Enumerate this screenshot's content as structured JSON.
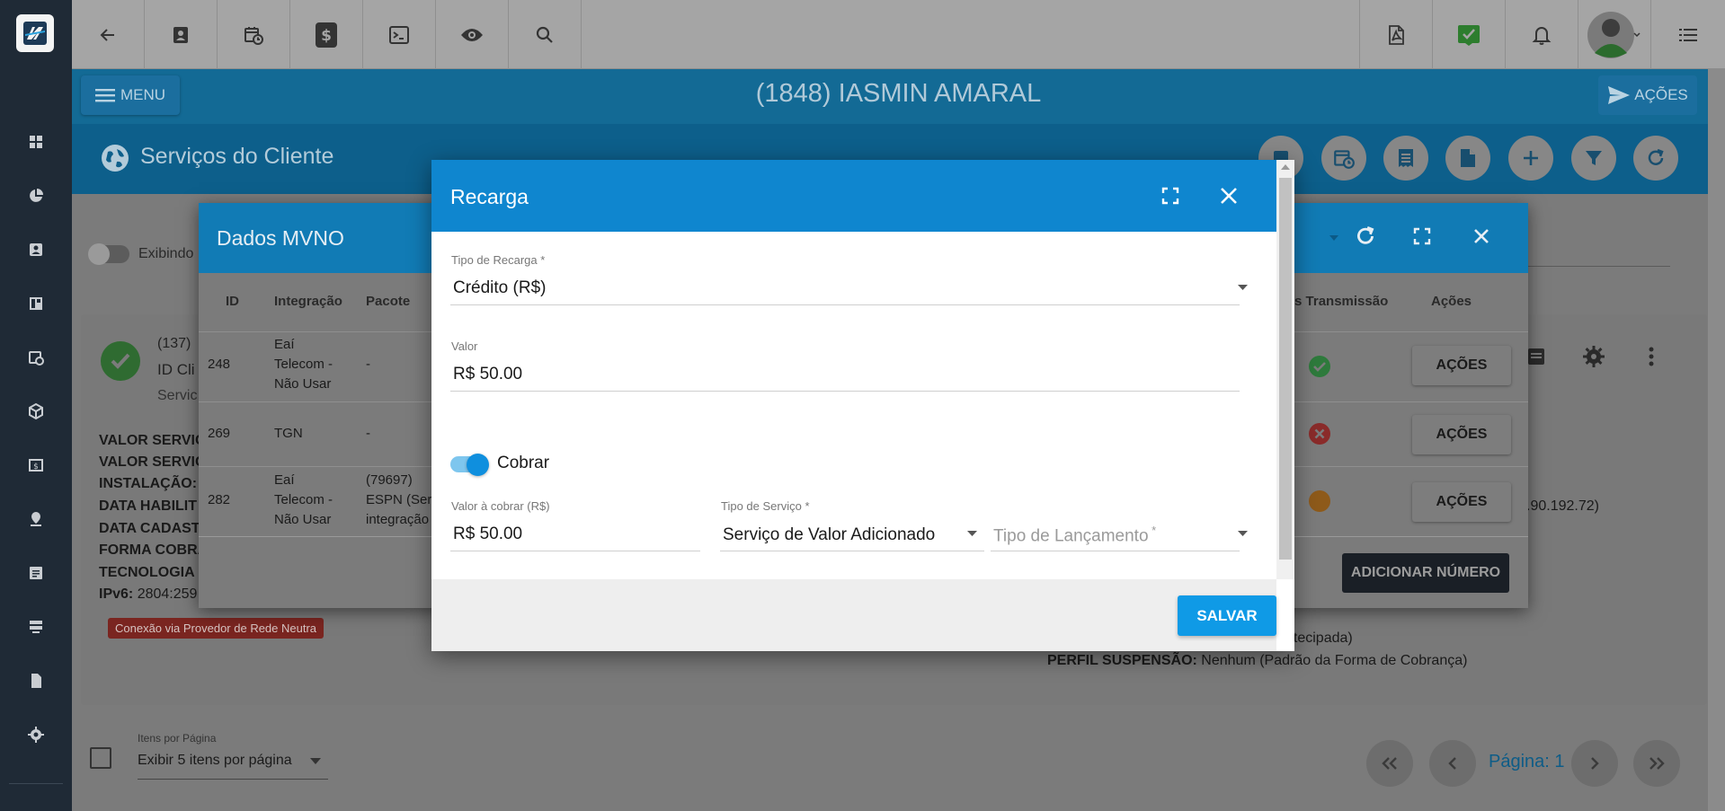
{
  "top_bar": {
    "icons": [
      "back-arrow-icon",
      "contact-card-icon",
      "schedule-icon",
      "dollar-icon",
      "terminal-icon",
      "eye-icon",
      "search-icon",
      "pdf-icon",
      "green-check-icon",
      "bell-icon",
      "user-avatar",
      "list-menu-icon"
    ]
  },
  "header": {
    "menu_label": "MENU",
    "client_title": "(1848) IASMIN AMARAL",
    "acoes_label": "AÇÕES",
    "section_title": "Serviços do Cliente"
  },
  "page": {
    "exibindo_label": "Exibindo",
    "card_id_prefix": "(137)",
    "card_id_cli": "ID Cli",
    "card_servic": "Servic",
    "kv_rows": [
      {
        "key": "VALOR SERVIC",
        "val": ""
      },
      {
        "key": "VALOR SERVIC",
        "val": ""
      },
      {
        "key": "INSTALAÇÃO:",
        "val": ""
      },
      {
        "key": "DATA HABILIT",
        "val": ""
      },
      {
        "key": "DATA CADAST",
        "val": ""
      },
      {
        "key": "FORMA COBRA",
        "val": ""
      },
      {
        "key": "TECNOLOGIA",
        "val": ""
      },
      {
        "key": "IPv6:",
        "val": " 2804:259"
      }
    ],
    "neutra_badge": "Conexão via Provedor de Rede Neutra",
    "right_ip": ".90.192.72)",
    "right_antecipada": "ntecipada)",
    "perfil_key": "PERFIL SUSPENSÃO:",
    "perfil_val": " Nenhum (Padrão da Forma de Cobrança)",
    "items_per_page_label": "Itens por Página",
    "items_per_page_value": "Exibir 5 itens por página",
    "pagina_label": "Página: 1"
  },
  "mvno_dialog": {
    "title": "Dados MVNO",
    "headers": {
      "id": "ID",
      "integracao": "Integração",
      "pacote": "Pacote",
      "transmissao": "Transmissão",
      "acoes": "Ações"
    },
    "header_transmissao_prefix": "s",
    "rows": [
      {
        "id": "248",
        "integracao": [
          "Eaí",
          "Telecom -",
          "Não Usar"
        ],
        "pacote": [
          "-"
        ],
        "status": "ok",
        "action": "AÇÕES"
      },
      {
        "id": "269",
        "integracao": [
          "TGN"
        ],
        "pacote": [
          "-"
        ],
        "status": "error",
        "action": "AÇÕES"
      },
      {
        "id": "282",
        "integracao": [
          "Eaí",
          "Telecom -",
          "Não Usar"
        ],
        "pacote": [
          "(79697)",
          "ESPN (Ser",
          "integração"
        ],
        "status": "pending",
        "action": "AÇÕES"
      }
    ],
    "status_colors": {
      "ok": "#2e9e48",
      "error": "#e53935",
      "pending": "#ff9800"
    },
    "add_number_label": "ADICIONAR NÚMERO"
  },
  "recarga_dialog": {
    "title": "Recarga",
    "tipo_recarga_label": "Tipo de Recarga",
    "tipo_recarga_value": "Crédito (R$)",
    "valor_label": "Valor",
    "valor_value": "R$ 50.00",
    "cobrar_label": "Cobrar",
    "cobrar_on": true,
    "valor_cobrar_label": "Valor à cobrar (R$)",
    "valor_cobrar_value": "R$ 50.00",
    "tipo_servico_label": "Tipo de Serviço",
    "tipo_servico_value": "Serviço de Valor Adicionado",
    "tipo_lancamento_placeholder": "Tipo de Lançamento",
    "required_mark": "*",
    "save_label": "SALVAR"
  },
  "colors": {
    "primary": "#0f86cf",
    "save": "#0f9ae6",
    "sidebar": "#1f2a36"
  }
}
